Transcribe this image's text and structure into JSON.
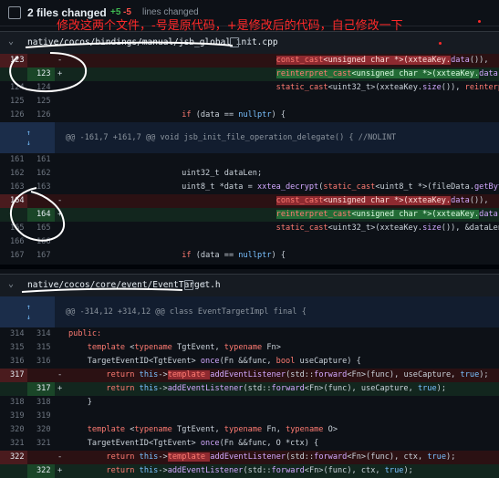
{
  "summary": {
    "title": "2 files changed",
    "additions": "+5",
    "deletions": "-5",
    "lines_changed": "lines changed"
  },
  "annotation": "修改这两个文件，-号是原代码，+是修改后的代码，自己修改一下",
  "files": [
    {
      "path": "native/cocos/bindings/manual/jsb_global_init.cpp",
      "rows": [
        {
          "type": "del",
          "old": "123",
          "new": "",
          "sign": "-",
          "parts": [
            {
              "t": "                                            "
            },
            {
              "t": "const_cast",
              "c": "k hl-del"
            },
            {
              "t": "<unsigned char *>(xxteaKey.",
              "c": "hl-del"
            },
            {
              "t": "data",
              "c": "f"
            },
            {
              "t": "()),"
            }
          ]
        },
        {
          "type": "add",
          "old": "",
          "new": "123",
          "sign": "+",
          "parts": [
            {
              "t": "                                            "
            },
            {
              "t": "reinterpret_cast",
              "c": "k hl-add"
            },
            {
              "t": "<unsigned char *>(xxteaKey.",
              "c": "hl-add"
            },
            {
              "t": "data",
              "c": "f"
            },
            {
              "t": "()),"
            }
          ]
        },
        {
          "type": "ctx",
          "old": "124",
          "new": "124",
          "sign": "",
          "parts": [
            {
              "t": "                                            "
            },
            {
              "t": "static_cast",
              "c": "k"
            },
            {
              "t": "<uint32_t>(xxteaKey."
            },
            {
              "t": "size",
              "c": "f"
            },
            {
              "t": "()), "
            },
            {
              "t": "reinterpret_cast",
              "c": "k"
            },
            {
              "t": "<uint32"
            }
          ]
        },
        {
          "type": "ctx",
          "old": "125",
          "new": "125",
          "sign": "",
          "parts": [
            {
              "t": ""
            }
          ]
        },
        {
          "type": "ctx",
          "old": "126",
          "new": "126",
          "sign": "",
          "parts": [
            {
              "t": "                        "
            },
            {
              "t": "if",
              "c": "k"
            },
            {
              "t": " (data == "
            },
            {
              "t": "nullptr",
              "c": "t"
            },
            {
              "t": ") {"
            }
          ]
        },
        {
          "type": "hunk",
          "text": "@@ -161,7 +161,7 @@ void jsb_init_file_operation_delegate() { //NOLINT"
        },
        {
          "type": "ctx",
          "old": "161",
          "new": "161",
          "sign": "",
          "parts": [
            {
              "t": ""
            }
          ]
        },
        {
          "type": "ctx",
          "old": "162",
          "new": "162",
          "sign": "",
          "parts": [
            {
              "t": "                        uint32_t dataLen;"
            }
          ]
        },
        {
          "type": "ctx",
          "old": "163",
          "new": "163",
          "sign": "",
          "parts": [
            {
              "t": "                        uint8_t *data = "
            },
            {
              "t": "xxtea_decrypt",
              "c": "f"
            },
            {
              "t": "("
            },
            {
              "t": "static_cast",
              "c": "k"
            },
            {
              "t": "<uint8_t *>(fileData."
            },
            {
              "t": "getBytes",
              "c": "f"
            },
            {
              "t": "()), "
            },
            {
              "t": "static_cast",
              "c": "k"
            },
            {
              "t": "<uint32"
            }
          ]
        },
        {
          "type": "del",
          "old": "164",
          "new": "",
          "sign": "-",
          "parts": [
            {
              "t": "                                            "
            },
            {
              "t": "const_cast",
              "c": "k hl-del"
            },
            {
              "t": "<unsigned char *>(xxteaKey.",
              "c": "hl-del"
            },
            {
              "t": "data",
              "c": "f"
            },
            {
              "t": "()),"
            }
          ]
        },
        {
          "type": "add",
          "old": "",
          "new": "164",
          "sign": "+",
          "parts": [
            {
              "t": "                                            "
            },
            {
              "t": "reinterpret_cast",
              "c": "k hl-add"
            },
            {
              "t": "<unsigned char *>(xxteaKey.",
              "c": "hl-add"
            },
            {
              "t": "data",
              "c": "f"
            },
            {
              "t": "()),"
            }
          ]
        },
        {
          "type": "ctx",
          "old": "165",
          "new": "165",
          "sign": "",
          "parts": [
            {
              "t": "                                            "
            },
            {
              "t": "static_cast",
              "c": "k"
            },
            {
              "t": "<uint32_t>(xxteaKey."
            },
            {
              "t": "size",
              "c": "f"
            },
            {
              "t": "()), &dataLen);"
            }
          ]
        },
        {
          "type": "ctx",
          "old": "166",
          "new": "166",
          "sign": "",
          "parts": [
            {
              "t": ""
            }
          ]
        },
        {
          "type": "ctx",
          "old": "167",
          "new": "167",
          "sign": "",
          "parts": [
            {
              "t": "                        "
            },
            {
              "t": "if",
              "c": "k"
            },
            {
              "t": " (data == "
            },
            {
              "t": "nullptr",
              "c": "t"
            },
            {
              "t": ") {"
            }
          ]
        }
      ]
    },
    {
      "path": "native/cocos/core/event/EventTarget.h",
      "rows": [
        {
          "type": "hunk",
          "text": "@@ -314,12 +314,12 @@ class EventTargetImpl final {"
        },
        {
          "type": "ctx",
          "old": "314",
          "new": "314",
          "sign": "",
          "parts": [
            {
              "t": "public:",
              "c": "k"
            }
          ]
        },
        {
          "type": "ctx",
          "old": "315",
          "new": "315",
          "sign": "",
          "parts": [
            {
              "t": "    "
            },
            {
              "t": "template",
              "c": "k"
            },
            {
              "t": " <"
            },
            {
              "t": "typename",
              "c": "k"
            },
            {
              "t": " TgtEvent, "
            },
            {
              "t": "typename",
              "c": "k"
            },
            {
              "t": " Fn>"
            }
          ]
        },
        {
          "type": "ctx",
          "old": "316",
          "new": "316",
          "sign": "",
          "parts": [
            {
              "t": "    TargetEventID<TgtEvent> "
            },
            {
              "t": "once",
              "c": "f"
            },
            {
              "t": "(Fn &&func, "
            },
            {
              "t": "bool",
              "c": "k"
            },
            {
              "t": " useCapture) {"
            }
          ]
        },
        {
          "type": "del",
          "old": "317",
          "new": "",
          "sign": "-",
          "parts": [
            {
              "t": "        "
            },
            {
              "t": "return",
              "c": "k"
            },
            {
              "t": " "
            },
            {
              "t": "this",
              "c": "t"
            },
            {
              "t": "->"
            },
            {
              "t": "template",
              "c": "k hl-del"
            },
            {
              "t": " ",
              "c": "hl-del"
            },
            {
              "t": "addEventListener",
              "c": "f"
            },
            {
              "t": "(std::"
            },
            {
              "t": "forward",
              "c": "f"
            },
            {
              "t": "<Fn>(func), useCapture, "
            },
            {
              "t": "true",
              "c": "t"
            },
            {
              "t": ");"
            }
          ]
        },
        {
          "type": "add",
          "old": "",
          "new": "317",
          "sign": "+",
          "parts": [
            {
              "t": "        "
            },
            {
              "t": "return",
              "c": "k"
            },
            {
              "t": " "
            },
            {
              "t": "this",
              "c": "t"
            },
            {
              "t": "->"
            },
            {
              "t": "addEventListener",
              "c": "f"
            },
            {
              "t": "(std::"
            },
            {
              "t": "forward",
              "c": "f"
            },
            {
              "t": "<Fn>(func), useCapture, "
            },
            {
              "t": "true",
              "c": "t"
            },
            {
              "t": ");"
            }
          ]
        },
        {
          "type": "ctx",
          "old": "318",
          "new": "318",
          "sign": "",
          "parts": [
            {
              "t": "    }"
            }
          ]
        },
        {
          "type": "ctx",
          "old": "319",
          "new": "319",
          "sign": "",
          "parts": [
            {
              "t": ""
            }
          ]
        },
        {
          "type": "ctx",
          "old": "320",
          "new": "320",
          "sign": "",
          "parts": [
            {
              "t": "    "
            },
            {
              "t": "template",
              "c": "k"
            },
            {
              "t": " <"
            },
            {
              "t": "typename",
              "c": "k"
            },
            {
              "t": " TgtEvent, "
            },
            {
              "t": "typename",
              "c": "k"
            },
            {
              "t": " Fn, "
            },
            {
              "t": "typename",
              "c": "k"
            },
            {
              "t": " O>"
            }
          ]
        },
        {
          "type": "ctx",
          "old": "321",
          "new": "321",
          "sign": "",
          "parts": [
            {
              "t": "    TargetEventID<TgtEvent> "
            },
            {
              "t": "once",
              "c": "f"
            },
            {
              "t": "(Fn &&func, O *ctx) {"
            }
          ]
        },
        {
          "type": "del",
          "old": "322",
          "new": "",
          "sign": "-",
          "parts": [
            {
              "t": "        "
            },
            {
              "t": "return",
              "c": "k"
            },
            {
              "t": " "
            },
            {
              "t": "this",
              "c": "t"
            },
            {
              "t": "->"
            },
            {
              "t": "template",
              "c": "k hl-del"
            },
            {
              "t": " ",
              "c": "hl-del"
            },
            {
              "t": "addEventListener",
              "c": "f"
            },
            {
              "t": "(std::"
            },
            {
              "t": "forward",
              "c": "f"
            },
            {
              "t": "<Fn>(func), ctx, "
            },
            {
              "t": "true",
              "c": "t"
            },
            {
              "t": ");"
            }
          ]
        },
        {
          "type": "add",
          "old": "",
          "new": "322",
          "sign": "+",
          "parts": [
            {
              "t": "        "
            },
            {
              "t": "return",
              "c": "k"
            },
            {
              "t": " "
            },
            {
              "t": "this",
              "c": "t"
            },
            {
              "t": "->"
            },
            {
              "t": "addEventListener",
              "c": "f"
            },
            {
              "t": "(std::"
            },
            {
              "t": "forward",
              "c": "f"
            },
            {
              "t": "<Fn>(func), ctx, "
            },
            {
              "t": "true",
              "c": "t"
            },
            {
              "t": ");"
            }
          ]
        }
      ]
    }
  ]
}
